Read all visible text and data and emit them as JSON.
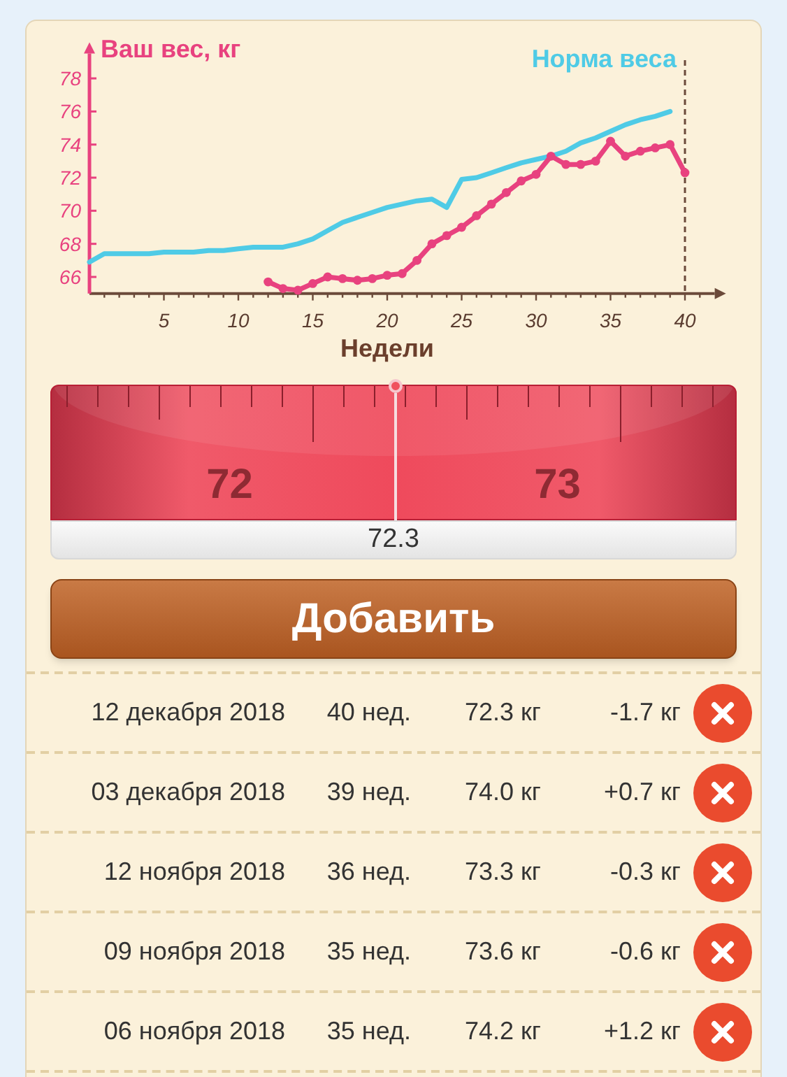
{
  "chart": {
    "chart_data": {
      "type": "line",
      "ylabel": "Ваш вес, кг",
      "xlabel": "Недели",
      "x": [
        0,
        1,
        2,
        3,
        4,
        5,
        6,
        7,
        8,
        9,
        10,
        11,
        12,
        13,
        14,
        15,
        16,
        17,
        18,
        19,
        20,
        21,
        22,
        23,
        24,
        25,
        26,
        27,
        28,
        29,
        30,
        31,
        32,
        33,
        34,
        35,
        36,
        37,
        38,
        39,
        40
      ],
      "series": [
        {
          "name": "Норма веса",
          "color": "#4fcbe6",
          "values": [
            66.9,
            67.4,
            67.4,
            67.4,
            67.4,
            67.5,
            67.5,
            67.5,
            67.6,
            67.6,
            67.7,
            67.8,
            67.8,
            67.8,
            68.0,
            68.3,
            68.8,
            69.3,
            69.6,
            69.9,
            70.2,
            70.4,
            70.6,
            70.7,
            70.2,
            71.9,
            72.0,
            72.3,
            72.6,
            72.9,
            73.1,
            73.3,
            73.6,
            74.1,
            74.4,
            74.8,
            75.2,
            75.5,
            75.7,
            76.0,
            null
          ]
        },
        {
          "color": "#e8427f",
          "marker": true,
          "values": [
            null,
            null,
            null,
            null,
            null,
            null,
            null,
            null,
            null,
            null,
            null,
            null,
            65.7,
            65.3,
            65.2,
            65.6,
            66.0,
            65.9,
            65.8,
            65.9,
            66.1,
            66.2,
            67.0,
            68.0,
            68.5,
            69.0,
            69.7,
            70.4,
            71.1,
            71.8,
            72.2,
            73.3,
            72.8,
            72.8,
            73.0,
            74.2,
            73.3,
            73.6,
            73.8,
            74.0,
            72.3
          ]
        }
      ],
      "xlim": [
        0,
        42
      ],
      "ylim": [
        65,
        79.5
      ],
      "xticks": [
        5,
        10,
        15,
        20,
        25,
        30,
        35,
        40
      ],
      "yticks": [
        66,
        68,
        70,
        72,
        74,
        76,
        78
      ],
      "ref_lines": [
        {
          "axis": "x",
          "value": 40
        }
      ]
    }
  },
  "ruler": {
    "labels": [
      "72",
      "73"
    ],
    "reading": "72.3"
  },
  "add_button": "Добавить",
  "entries": [
    {
      "date": "12 декабря 2018",
      "week": "40 нед.",
      "weight": "72.3 кг",
      "change": "-1.7 кг"
    },
    {
      "date": "03 декабря 2018",
      "week": "39 нед.",
      "weight": "74.0 кг",
      "change": "+0.7 кг"
    },
    {
      "date": "12 ноября 2018",
      "week": "36 нед.",
      "weight": "73.3 кг",
      "change": "-0.3 кг"
    },
    {
      "date": "09 ноября 2018",
      "week": "35 нед.",
      "weight": "73.6 кг",
      "change": "-0.6 кг"
    },
    {
      "date": "06 ноября 2018",
      "week": "35 нед.",
      "weight": "74.2 кг",
      "change": "+1.2 кг"
    }
  ]
}
